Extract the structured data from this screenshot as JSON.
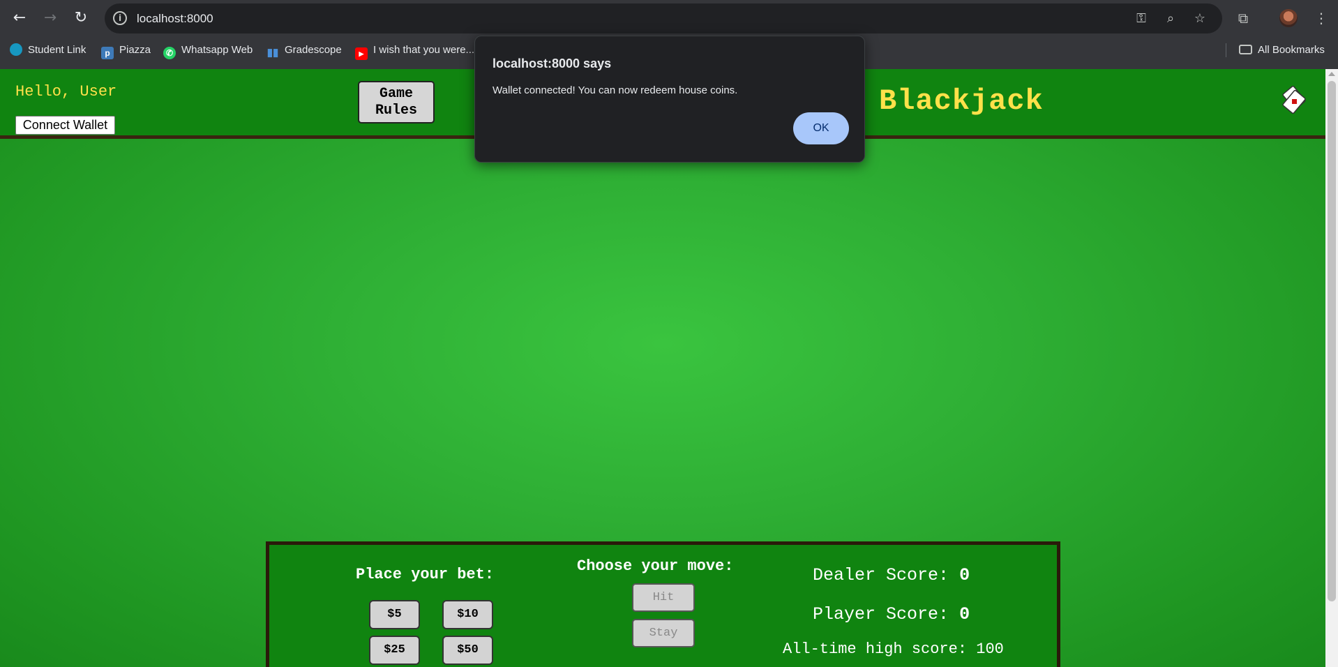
{
  "browser": {
    "url": "localhost:8000",
    "bookmarks": [
      {
        "label": "Student Link",
        "icon": "salesforce-cloud-icon",
        "color": "#1798c1"
      },
      {
        "label": "Piazza",
        "icon": "piazza-icon",
        "color": "#3e7ab8"
      },
      {
        "label": "Whatsapp Web",
        "icon": "whatsapp-icon",
        "color": "#25d366"
      },
      {
        "label": "Gradescope",
        "icon": "gradescope-bars-icon",
        "color": "#4a90d9"
      },
      {
        "label": "I wish that you were...",
        "icon": "youtube-icon",
        "color": "#ff0000"
      }
    ],
    "all_bookmarks_label": "All Bookmarks"
  },
  "header": {
    "greeting": "Hello, User",
    "connect_wallet_label": "Connect Wallet",
    "game_rules_line1": "Game",
    "game_rules_line2": "Rules",
    "title": "Blackjack",
    "title_color": "#ffe14a"
  },
  "panel": {
    "bet_heading": "Place your bet:",
    "bets": [
      "$5",
      "$10",
      "$25",
      "$50"
    ],
    "move_heading": "Choose your move:",
    "hit_label": "Hit",
    "stay_label": "Stay",
    "dealer_score_label": "Dealer Score:",
    "dealer_score": "0",
    "player_score_label": "Player Score:",
    "player_score": "0",
    "high_score_text": "All-time high score: 100"
  },
  "dialog": {
    "title": "localhost:8000 says",
    "message": "Wallet connected! You can now redeem house coins.",
    "ok_label": "OK"
  },
  "colors": {
    "felt_green": "#2fb035",
    "header_green": "#108410",
    "dialog_button": "#a8c7fa"
  }
}
